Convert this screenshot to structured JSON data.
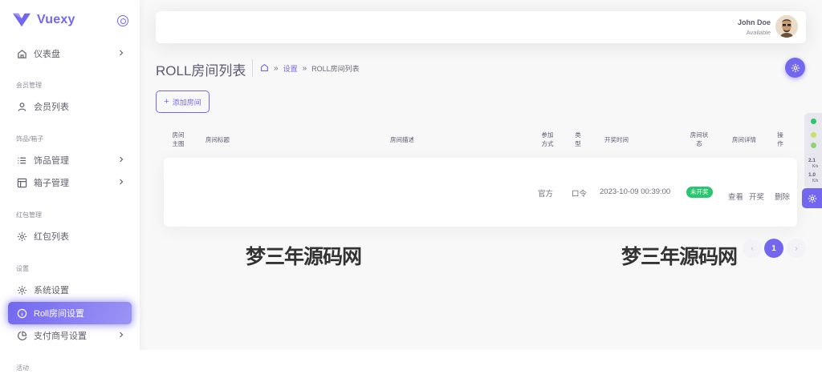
{
  "brand": {
    "name": "Vuexy"
  },
  "sidebar": {
    "dashboard": "仪表盘",
    "sections": {
      "members": "会员管理",
      "items": "饰品/箱子",
      "redpacket": "红包管理",
      "settings": "设置",
      "activity": "活动"
    },
    "member_list": "会员列表",
    "item_management": "饰品管理",
    "box_management": "箱子管理",
    "redpacket_list": "红包列表",
    "system_settings": "系统设置",
    "roll_room_settings": "Roll房间设置",
    "payment_settings": "支付商号设置"
  },
  "navbar": {
    "user_name": "John Doe",
    "user_status": "Available"
  },
  "page": {
    "title": "ROLL房间列表",
    "breadcrumb_sep": "»",
    "breadcrumb_settings": "设置",
    "breadcrumb_current": "ROLL房间列表",
    "add_button": "添加房间"
  },
  "table": {
    "headers": {
      "main_image": "房间主图",
      "room_title": "房间标题",
      "room_desc": "房间描述",
      "join_method": "参加方式",
      "type": "类型",
      "draw_time": "开奖时间",
      "room_status": "房间状态",
      "room_detail": "房间详情",
      "action": "操作"
    },
    "rows": [
      {
        "join_method": "官方",
        "type": "口令",
        "draw_time": "2023-10-09 00:39:00",
        "status": "未开奖",
        "view": "查看",
        "draw": "开奖",
        "delete": "删除"
      }
    ]
  },
  "pagination": {
    "current": "1",
    "prev": "‹",
    "next": "›"
  },
  "watermarks": [
    "梦三年源码网",
    "梦三年源码网"
  ],
  "dock": {
    "val1": "2.1",
    "unit1": "K/s",
    "val2": "1.0",
    "unit2": "K/s"
  },
  "colors": {
    "primary": "#7367f0",
    "success": "#28c76f"
  }
}
